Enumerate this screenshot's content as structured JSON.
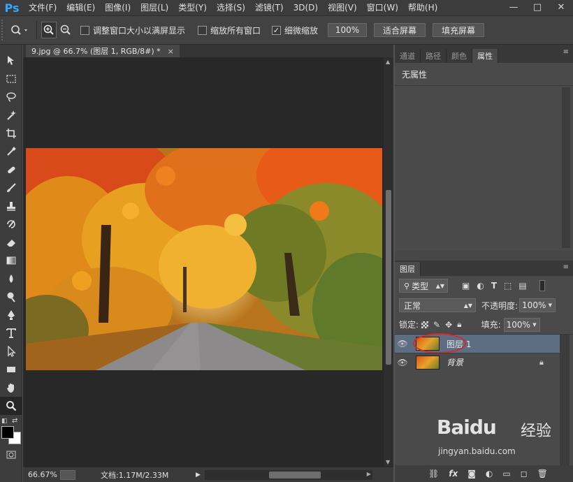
{
  "app": {
    "logo": "Ps"
  },
  "menu": [
    "文件(F)",
    "编辑(E)",
    "图像(I)",
    "图层(L)",
    "类型(Y)",
    "选择(S)",
    "滤镜(T)",
    "3D(D)",
    "视图(V)",
    "窗口(W)",
    "帮助(H)"
  ],
  "window_controls": {
    "minimize": "—",
    "restore": "□",
    "close": "✕"
  },
  "options": {
    "resize_windows_label": "调整窗口大小以满屏显示",
    "zoom_all_label": "缩放所有窗口",
    "scrubby_label": "细微缩放",
    "scrubby_checked": "✓",
    "zoom100_label": "100%",
    "fit_screen_label": "适合屏幕",
    "fill_screen_label": "填充屏幕"
  },
  "document": {
    "tab_title": "9.jpg @ 66.7% (图层 1, RGB/8#) *",
    "close_glyph": "×"
  },
  "status": {
    "zoom": "66.67%",
    "doc_info": "文档:1.17M/2.33M"
  },
  "panels": {
    "top_tabs": [
      "通道",
      "路径",
      "颜色",
      "属性"
    ],
    "properties_text": "无属性",
    "layers_tab": "图层",
    "filter_kind": "类型",
    "blend_mode": "正常",
    "opacity_label": "不透明度:",
    "opacity_value": "100%",
    "lock_label": "锁定:",
    "fill_label": "填充:",
    "fill_value": "100%",
    "layers": [
      {
        "name": "图层 1",
        "selected": true
      },
      {
        "name": "背景",
        "selected": false,
        "locked": true
      }
    ]
  },
  "watermark": {
    "brand": "Baidu",
    "brand_cn": "经验",
    "url": "jingyan.baidu.com"
  },
  "colors": {
    "accent": "#31a8ff",
    "selected_layer": "#5d6d82",
    "highlight_circle": "#d42a2a"
  }
}
